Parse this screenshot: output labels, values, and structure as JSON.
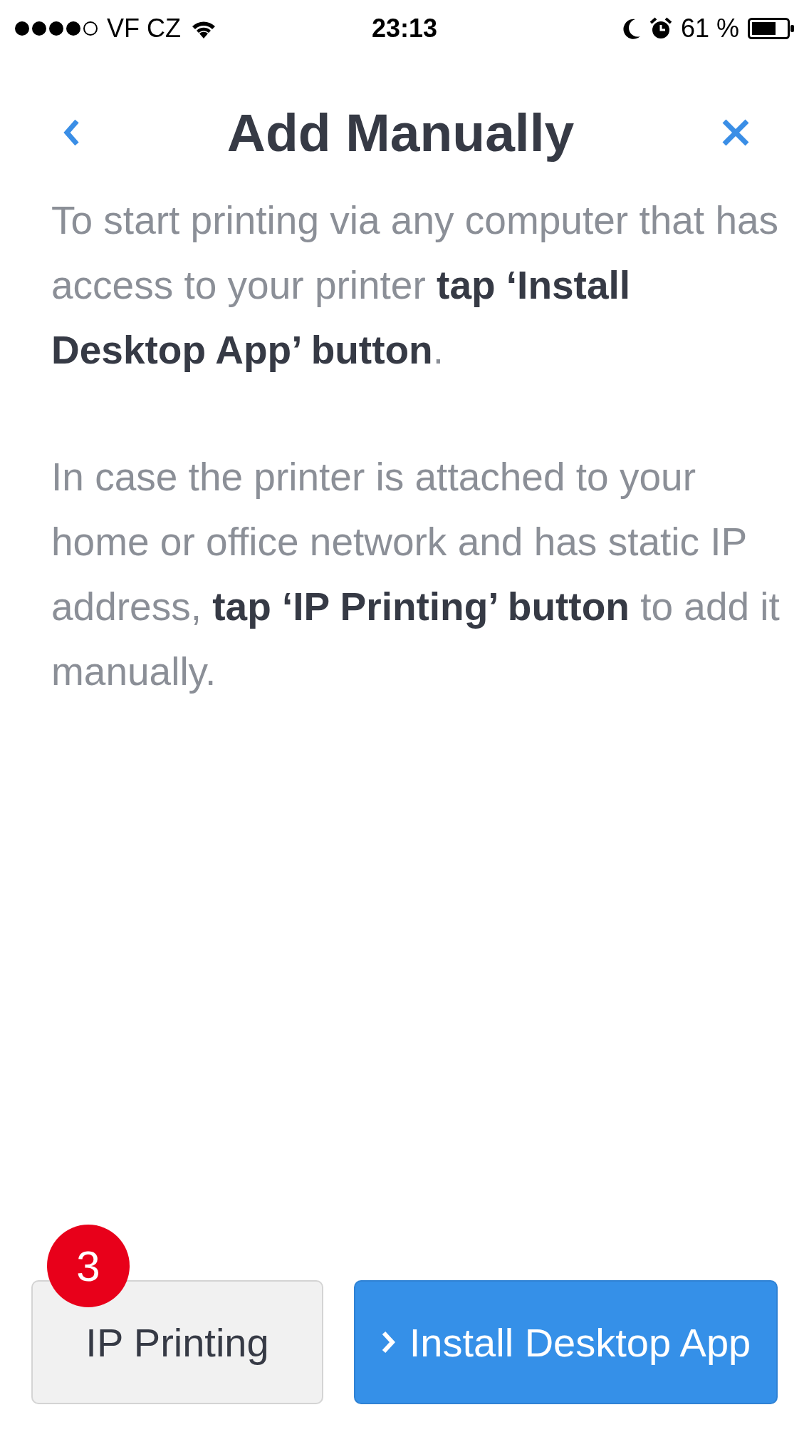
{
  "status_bar": {
    "carrier": "VF CZ",
    "time": "23:13",
    "battery": "61 %"
  },
  "nav": {
    "title": "Add Manually"
  },
  "paragraphs": [
    "To start printing via any computer that has access to your printer **tap ‘Install Desktop App’ button**.",
    "In case the printer is attached to your home or office network and has static IP address, **tap ‘IP Printing’ button** to add it manually."
  ],
  "buttons": [
    {
      "kind": "secondary",
      "label": "IP Printing",
      "badge": "3"
    },
    {
      "kind": "primary",
      "label": "Install Desktop App"
    }
  ]
}
